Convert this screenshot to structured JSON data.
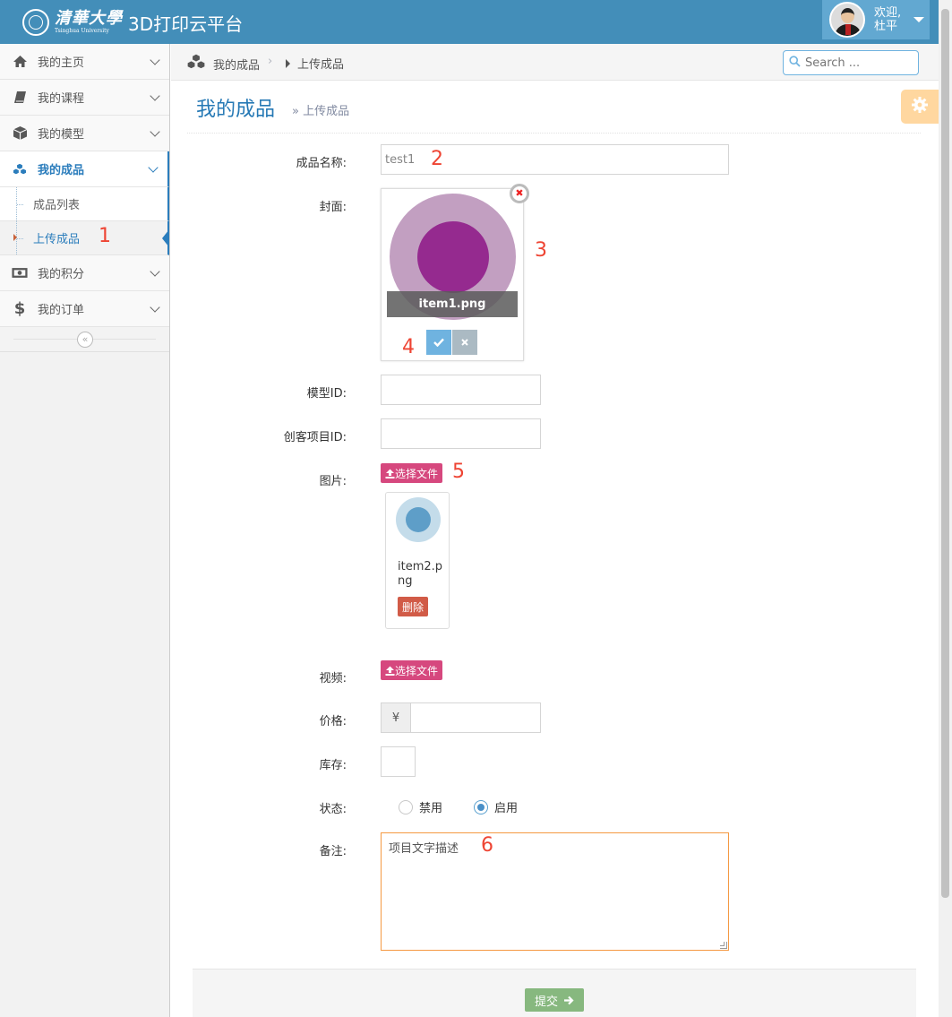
{
  "navbar": {
    "brand_calligraphy": "清華大學",
    "brand_en": "Tsinghua University",
    "title": "3D打印云平台",
    "welcome": "欢迎,",
    "username": "杜平"
  },
  "sidebar": {
    "items": [
      {
        "label": "我的主页",
        "icon": "home-icon"
      },
      {
        "label": "我的课程",
        "icon": "book-icon"
      },
      {
        "label": "我的模型",
        "icon": "cube-icon"
      },
      {
        "label": "我的成品",
        "icon": "cubes-icon",
        "active": true
      },
      {
        "label": "我的积分",
        "icon": "money-icon"
      },
      {
        "label": "我的订单",
        "icon": "dollar-icon"
      }
    ],
    "subitems": [
      {
        "label": "成品列表"
      },
      {
        "label": "上传成品",
        "active": true
      }
    ],
    "collapse_glyph": "«"
  },
  "breadcrumbs": {
    "home": "我的成品",
    "separator": "›",
    "current": "上传成品"
  },
  "search": {
    "placeholder": "Search ..."
  },
  "header": {
    "title": "我的成品",
    "subtitle": "» 上传成品"
  },
  "form": {
    "name_label": "成品名称:",
    "name_value": "test1",
    "cover_label": "封面:",
    "cover_filename": "item1.png",
    "cover_colors": {
      "outer": "#c29fc1",
      "inner": "#952a8f"
    },
    "model_id_label": "模型ID:",
    "project_id_label": "创客项目ID:",
    "image_label": "图片:",
    "pick_file": "选择文件",
    "image_filename": "item2.png",
    "delete": "删除",
    "video_label": "视频:",
    "video_pick_file": "选择文件",
    "price_label": "价格:",
    "price_prefix": "¥",
    "stock_label": "库存:",
    "status_label": "状态:",
    "status_options": [
      "禁用",
      "启用"
    ],
    "status_selected": "启用",
    "remark_label": "备注:",
    "remark_value": "项目文字描述",
    "submit": "提交"
  },
  "annotations": [
    "1",
    "2",
    "3",
    "4",
    "5",
    "6"
  ],
  "colors": {
    "navbar": "#438eb9",
    "accent": "#2b7dbc",
    "pink_button": "#d6487e",
    "danger": "#d15b47",
    "success": "#87b87f",
    "warning": "#ffb752"
  }
}
